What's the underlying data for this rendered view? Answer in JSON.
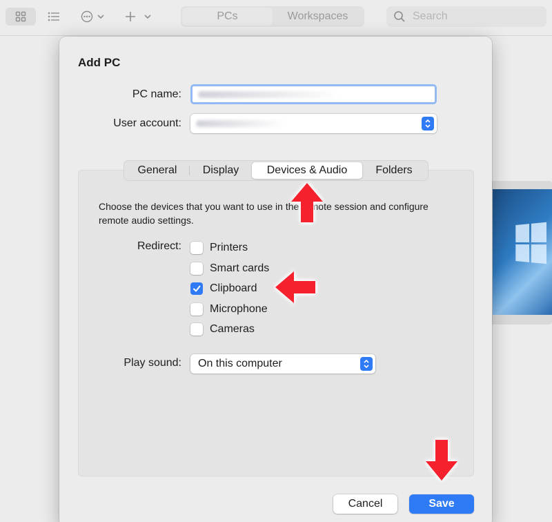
{
  "toolbar": {
    "view_icons": [
      "grid-view-icon",
      "list-view-icon",
      "more-icon",
      "add-icon"
    ],
    "segments": [
      "PCs",
      "Workspaces"
    ],
    "active_segment": "PCs",
    "search_placeholder": "Search"
  },
  "dialog": {
    "title": "Add PC",
    "pc_name_label": "PC name:",
    "pc_name_value": "",
    "user_account_label": "User account:",
    "user_account_value": "",
    "tabs": [
      "General",
      "Display",
      "Devices & Audio",
      "Folders"
    ],
    "active_tab": "Devices & Audio",
    "description": "Choose the devices that you want to use in the remote session and configure remote audio settings.",
    "redirect_label": "Redirect:",
    "devices": [
      {
        "label": "Printers",
        "checked": false
      },
      {
        "label": "Smart cards",
        "checked": false
      },
      {
        "label": "Clipboard",
        "checked": true
      },
      {
        "label": "Microphone",
        "checked": false
      },
      {
        "label": "Cameras",
        "checked": false
      }
    ],
    "play_sound_label": "Play sound:",
    "play_sound_value": "On this computer",
    "cancel_label": "Cancel",
    "save_label": "Save"
  },
  "colors": {
    "accent": "#2f7bf5",
    "annotation_arrow": "#f5222d"
  }
}
